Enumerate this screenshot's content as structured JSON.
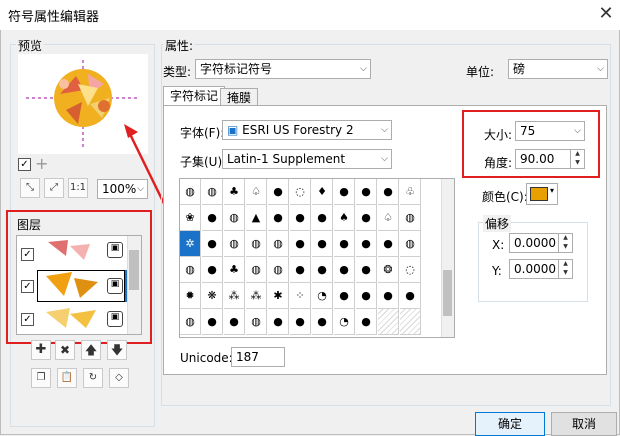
{
  "window": {
    "title": "符号属性编辑器"
  },
  "preview": {
    "label": "预览",
    "zoom": "100%"
  },
  "layers": {
    "label": "图层",
    "rows": [
      {
        "checked": true
      },
      {
        "checked": true
      },
      {
        "checked": true
      }
    ]
  },
  "properties": {
    "label": "属性:",
    "type_label": "类型:",
    "type_value": "字符标记符号",
    "unit_label": "单位:",
    "unit_value": "磅"
  },
  "tabs": [
    {
      "label": "字符标记"
    },
    {
      "label": "掩膜"
    }
  ],
  "font": {
    "label": "字体(F):",
    "value": "ESRI US Forestry 2"
  },
  "subset": {
    "label": "子集(U):",
    "value": "Latin-1 Supplement"
  },
  "size": {
    "label": "大小:",
    "value": "75"
  },
  "angle": {
    "label": "角度:",
    "value": "90.00"
  },
  "color": {
    "label": "颜色(C):",
    "swatch": "#e8a000"
  },
  "offset": {
    "label": "偏移",
    "x_label": "X:",
    "x_value": "0.0000",
    "y_label": "Y:",
    "y_value": "0.0000"
  },
  "unicode": {
    "label": "Unicode:",
    "value": "187"
  },
  "buttons": {
    "ok": "确定",
    "cancel": "取消"
  },
  "colors": {
    "highlight": "#e02020",
    "selection": "#1a73c9"
  }
}
